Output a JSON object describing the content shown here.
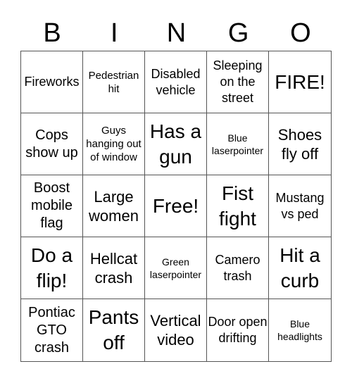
{
  "header": [
    "B",
    "I",
    "N",
    "G",
    "O"
  ],
  "cells": [
    {
      "text": "Fireworks",
      "size": "m"
    },
    {
      "text": "Pedestrian hit",
      "size": "s"
    },
    {
      "text": "Disabled vehicle",
      "size": "m"
    },
    {
      "text": "Sleeping on the street",
      "size": "m"
    },
    {
      "text": "FIRE!",
      "size": "xl"
    },
    {
      "text": "Cops show up",
      "size": "ml"
    },
    {
      "text": "Guys hanging out of window",
      "size": "s"
    },
    {
      "text": "Has a gun",
      "size": "xl"
    },
    {
      "text": "Blue laserpointer",
      "size": "xs"
    },
    {
      "text": "Shoes fly off",
      "size": "l"
    },
    {
      "text": "Boost mobile flag",
      "size": "ml"
    },
    {
      "text": "Large women",
      "size": "l"
    },
    {
      "text": "Free!",
      "size": "xl"
    },
    {
      "text": "Fist fight",
      "size": "xl"
    },
    {
      "text": "Mustang vs ped",
      "size": "m"
    },
    {
      "text": "Do a flip!",
      "size": "xl"
    },
    {
      "text": "Hellcat crash",
      "size": "l"
    },
    {
      "text": "Green laserpointer",
      "size": "xs"
    },
    {
      "text": "Camero trash",
      "size": "m"
    },
    {
      "text": "Hit a curb",
      "size": "xl"
    },
    {
      "text": "Pontiac GTO crash",
      "size": "ml"
    },
    {
      "text": "Pants off",
      "size": "xl"
    },
    {
      "text": "Vertical video",
      "size": "l"
    },
    {
      "text": "Door open drifting",
      "size": "m"
    },
    {
      "text": "Blue headlights",
      "size": "xs"
    }
  ]
}
